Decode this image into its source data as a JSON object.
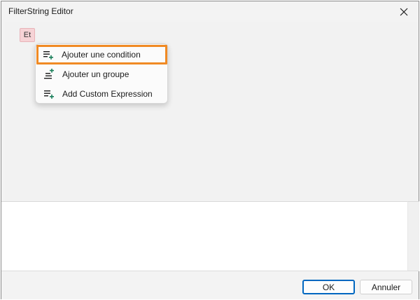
{
  "window": {
    "title": "FilterString Editor"
  },
  "editor": {
    "group_operator": "Et"
  },
  "context_menu": {
    "items": [
      {
        "label": "Ajouter une condition",
        "icon": "add-condition-icon",
        "highlighted": true
      },
      {
        "label": "Ajouter un groupe",
        "icon": "add-group-icon",
        "highlighted": false
      },
      {
        "label": "Add Custom Expression",
        "icon": "add-expression-icon",
        "highlighted": false
      }
    ]
  },
  "buttons": {
    "ok": "OK",
    "cancel": "Annuler"
  },
  "colors": {
    "highlight_border": "#f08a24",
    "icon_green": "#1a7f5a",
    "group_operator_bg": "#f6d3d6",
    "ok_border": "#0067c0"
  }
}
